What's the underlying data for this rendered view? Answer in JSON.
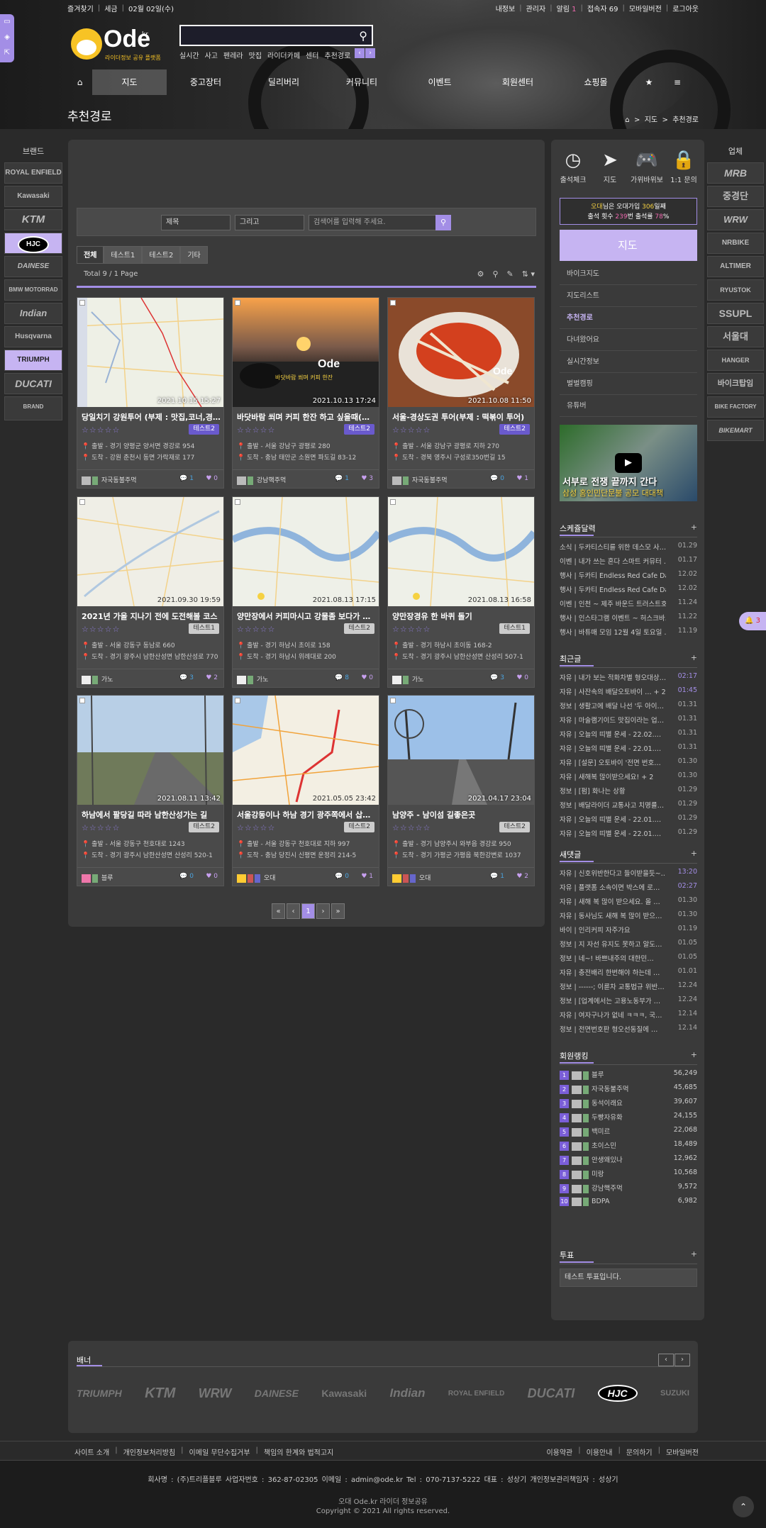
{
  "topbar": {
    "left": [
      "즐겨찾기",
      "세금",
      "02월 02일(수)"
    ],
    "right": [
      "내정보",
      "관리자",
      "알림",
      "1",
      "접속자 69",
      "모바일버전",
      "로그아웃"
    ]
  },
  "logo": {
    "text": "Ode",
    "suffix": "kr",
    "sub": "라이더정보 공유 플랫폼"
  },
  "keywords": [
    "실시간",
    "사고",
    "펜레라",
    "맛집",
    "라이더카페",
    "센터",
    "추천경로"
  ],
  "nav": [
    "지도",
    "중고장터",
    "딜리버리",
    "커뮤니티",
    "이벤트",
    "회원센터",
    "쇼핑몰"
  ],
  "page": {
    "title": "추천경로",
    "breadcrumb": [
      "지도",
      "추천경로"
    ]
  },
  "left_brands_title": "브랜드",
  "left_brands": [
    "ROYAL ENFIELD",
    "Kawasaki",
    "KTM",
    "HJC",
    "DAINESE",
    "BMW MOTORRAD",
    "Indian",
    "Husqvarna",
    "TRIUMPH",
    "DUCATI",
    "BRAND"
  ],
  "right_brands_title": "업체",
  "right_brands": [
    "MRB",
    "중경단",
    "WRW",
    "NRBIKE",
    "ALTIMER",
    "RYUSTOK",
    "SSUPL",
    "서울대",
    "HANGER",
    "바이크탑임",
    "BIKE FACTORY",
    "BIKEMART"
  ],
  "filters": {
    "field": "제목",
    "cond": "그리고",
    "placeholder": "검색어를 입력해 주세요."
  },
  "tabs": [
    "전체",
    "테스트1",
    "테스트2",
    "기타"
  ],
  "total": "Total 9 / 1 Page",
  "cards": [
    {
      "title": "당일치기 강원투어 (부제 : 맛집,코너,경…",
      "date": "2021.10.15 15:27",
      "badge": "테스트2",
      "from": "출발 - 경기 양평군 양서면 경강로 954",
      "to": "도착 - 강원 춘천시 동면 가락재로 177",
      "user": "자국동불주먹",
      "comments": "1",
      "likes": "0"
    },
    {
      "title": "바닷바람 쐬며 커피 한잔 하고 싶을때(…",
      "date": "2021.10.13 17:24",
      "badge": "테스트2",
      "from": "출발 - 서울 강남구 광평로 280",
      "to": "도착 - 충남 태안군 소원면 파도길 83-12",
      "user": "강남핵주먹",
      "comments": "1",
      "likes": "3"
    },
    {
      "title": "서울-경상도권 투어(부제 : 떡볶이 투어)",
      "date": "2021.10.08 11:50",
      "badge": "테스트2",
      "from": "출발 - 서울 강남구 광평로 지하 270",
      "to": "도착 - 경북 영주시 구성로350번길 15",
      "user": "자국동불주먹",
      "comments": "0",
      "likes": "1"
    },
    {
      "title": "2021년 가을 지나기 전에 도전해볼 코스",
      "date": "2021.09.30 19:59",
      "badge": "테스트1",
      "from": "출발 - 서울 강동구 동남로 660",
      "to": "도착 - 경기 광주시 남한산성면 남한산성로 770",
      "user": "가노",
      "comments": "3",
      "likes": "2"
    },
    {
      "title": "양만장에서 커피마시고 강물좀 보다가 …",
      "date": "2021.08.13 17:15",
      "badge": "테스트2",
      "from": "출발 - 경기 하남시 초이로 158",
      "to": "도착 - 경기 하남시 위례대로 200",
      "user": "가노",
      "comments": "8",
      "likes": "0"
    },
    {
      "title": "양만장경유 한 바퀴 돌기",
      "date": "2021.08.13 16:58",
      "badge": "테스트1",
      "from": "출발 - 경기 하남시 초이동 168-2",
      "to": "도착 - 경기 광주시 남한산성면 산성리 507-1",
      "user": "가노",
      "comments": "3",
      "likes": "0"
    },
    {
      "title": "하남에서 팔당길 따라 남한산성가는 길",
      "date": "2021.08.11 13:42",
      "badge": "테스트2",
      "from": "출발 - 서울 강동구 천호대로 1243",
      "to": "도착 - 경기 광주시 남한산성면 산성리 520-1",
      "user": "블루",
      "comments": "0",
      "likes": "0"
    },
    {
      "title": "서울강동이나 하남 경기 광주쪽에서 삽…",
      "date": "2021.05.05 23:42",
      "badge": "테스트2",
      "from": "출발 - 서울 강동구 천호대로 지하 997",
      "to": "도착 - 충남 당진시 신평면 운정리 214-5",
      "user": "오대",
      "comments": "0",
      "likes": "1"
    },
    {
      "title": "남양주 - 남이섬 길좋은곳",
      "date": "2021.04.17 23:04",
      "badge": "테스트2",
      "from": "출발 - 경기 남양주시 와부읍 경강로 950",
      "to": "도착 - 경기 가평군 가평읍 북한강변로 1037",
      "user": "오대",
      "comments": "1",
      "likes": "2"
    }
  ],
  "pager": [
    "«",
    "‹",
    "1",
    "›",
    "»"
  ],
  "quick": [
    "출석체크",
    "지도",
    "가위바위보",
    "1:1 문의"
  ],
  "attend": {
    "line1a": "오대",
    "line1b": "님은 오대가입 ",
    "days": "306",
    "line1c": "일째",
    "line2a": "출석 횟수 ",
    "count": "239",
    "line2b": "번 출석률 ",
    "rate": "78",
    "line2c": "%"
  },
  "map_title": "지도",
  "menu": [
    "바이크지도",
    "지도리스트",
    "추천경로",
    "다녀왔어요",
    "실시간정보",
    "벌벌캠핑",
    "유튜버"
  ],
  "video": {
    "cap": "서부로 전쟁 끝까지 간다",
    "cap2": "삼성 홈인민단문불 공모 대대책"
  },
  "sec_schedule": {
    "title": "스케쥴달력",
    "items": [
      [
        "소식 | 두카티스티를 위한 데스모 사…",
        "01.29"
      ],
      [
        "이벤 | 내가 쓰는 혼다 스마트 커뮤터 …",
        "01.17"
      ],
      [
        "행사 | 두카티 Endless Red Cafe Day",
        "12.02"
      ],
      [
        "행사 | 두카티 Endless Red Cafe Day",
        "12.02"
      ],
      [
        "이벤 | 인천 ~ 제주 바운드 트러스트호…",
        "11.24"
      ],
      [
        "행사 | 인스타그램 이벤트 ~ 허스크바…",
        "11.22"
      ],
      [
        "행사 | 바튜매 모임 12월 4일 토요일 …",
        "11.19"
      ]
    ]
  },
  "sec_recent": {
    "title": "최근글",
    "items": [
      [
        "자유 | 내가 보는 적화차별 형오대상…",
        "02:17"
      ],
      [
        "자유 | 사잔속의 배달오토바이 … + 2",
        "01:45"
      ],
      [
        "정보 | 생활고에 배달 나선 '두 아이…",
        "01.31"
      ],
      [
        "자유 | 마술램기이드 맛집이라는 업…",
        "01.31"
      ],
      [
        "자유 | 오늘의 띠별 운세 - 22.02.…",
        "01.31"
      ],
      [
        "자유 | 오늘의 띠별 운세 - 22.01.…",
        "01.31"
      ],
      [
        "자유 | [설문] 오토바이 '전면 번호…",
        "01.30"
      ],
      [
        "자유 | 새해복 많이받으세요! + 2",
        "01.30"
      ],
      [
        "정보 | [펌] 화나는 상황",
        "01.29"
      ],
      [
        "정보 | 배달라이더 교통사고 치명률…",
        "01.29"
      ],
      [
        "자유 | 오늘의 띠별 운세 - 22.01.…",
        "01.29"
      ],
      [
        "자유 | 오늘의 띠별 운세 - 22.01.…",
        "01.29"
      ]
    ]
  },
  "sec_comments": {
    "title": "새댓글",
    "items": [
      [
        "자유 | 신호위반한다고 들이받을듯~…",
        "13:20"
      ],
      [
        "자유 | 플랫폼 소속이면 박스에 로…",
        "02:27"
      ],
      [
        "자유 | 새해 복 많이 받으세요. 올 …",
        "01.30"
      ],
      [
        "자유 | 동사님도 새해 복 많이 받으…",
        "01.30"
      ],
      [
        "바이 | 인리커피 자주가요",
        "01.19"
      ],
      [
        "정보 | 지 자선 유지도 못하고 알도…",
        "01.05"
      ],
      [
        "정보 | 네~! 바쁘내주의 대한민…",
        "01.05"
      ],
      [
        "자유 | 충전배리 한번해야 하는데 …",
        "01.01"
      ],
      [
        "정보 | ------; 이륜차 교통법규 위반…",
        "12.24"
      ],
      [
        "정보 | [업계에서는 고용노동부가 …",
        "12.24"
      ],
      [
        "자유 | 여자구나가 없네 ㅋㅋㅋ, 국…",
        "12.14"
      ],
      [
        "정보 | 전면번호판 형오선동질에 …",
        "12.14"
      ]
    ]
  },
  "sec_rank": {
    "title": "회원랭킹",
    "items": [
      [
        "1",
        "블루",
        "56,249"
      ],
      [
        "2",
        "자국동불주먹",
        "45,685"
      ],
      [
        "3",
        "동석이래요",
        "39,607"
      ],
      [
        "4",
        "두빵자유화",
        "24,155"
      ],
      [
        "5",
        "백미르",
        "22,068"
      ],
      [
        "6",
        "초이스민",
        "18,489"
      ],
      [
        "7",
        "안생왜있나",
        "12,962"
      ],
      [
        "8",
        "미랑",
        "10,568"
      ],
      [
        "9",
        "강남핵주먹",
        "9,572"
      ],
      [
        "10",
        "BDPA",
        "6,982"
      ]
    ]
  },
  "sec_poll": {
    "title": "투표",
    "item": "테스트 투표입니다."
  },
  "banner": {
    "title": "배너",
    "logos": [
      "TRIUMPH",
      "KTM",
      "WRW",
      "DAINESE",
      "Kawasaki",
      "Indian",
      "ROYAL ENFIELD",
      "DUCATI",
      "HJC",
      "SUZUKI"
    ]
  },
  "footer_links_left": [
    "사이트 소개",
    "개인정보처리방침",
    "이메일 무단수집거부",
    "책임의 한계와 법적고지"
  ],
  "footer_links_right": [
    "이용약관",
    "이용안내",
    "문의하기",
    "모바일버전"
  ],
  "footer": {
    "info": "회사명 : (주)트리플블루    사업자번호 : 362-87-02305    이메일 : admin@ode.kr    Tel : 070-7137-5222    대표 : 성상기    개인정보관리책임자 : 성상기",
    "c1": "오대 Ode.kr 라이더 정보공유",
    "c2": "Copyright © 2021 All rights reserved."
  },
  "notice_count": "3",
  "colors": {
    "accent": "#a38ee6",
    "accent_light": "#c6b4f2"
  }
}
